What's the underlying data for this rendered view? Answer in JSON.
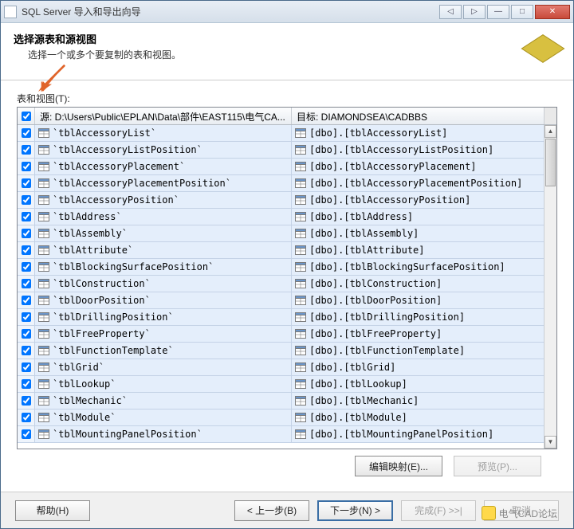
{
  "window": {
    "title": "SQL Server 导入和导出向导"
  },
  "header": {
    "title": "选择源表和源视图",
    "subtitle": "选择一个或多个要复制的表和视图。"
  },
  "section_label": "表和视图(T):",
  "columns": {
    "source": "源: D:\\Users\\Public\\EPLAN\\Data\\部件\\EAST115\\电气CA...",
    "target": "目标: DIAMONDSEA\\CADBBS"
  },
  "rows": [
    {
      "src": "`tblAccessoryList`",
      "tgt": "[dbo].[tblAccessoryList]"
    },
    {
      "src": "`tblAccessoryListPosition`",
      "tgt": "[dbo].[tblAccessoryListPosition]"
    },
    {
      "src": "`tblAccessoryPlacement`",
      "tgt": "[dbo].[tblAccessoryPlacement]"
    },
    {
      "src": "`tblAccessoryPlacementPosition`",
      "tgt": "[dbo].[tblAccessoryPlacementPosition]"
    },
    {
      "src": "`tblAccessoryPosition`",
      "tgt": "[dbo].[tblAccessoryPosition]"
    },
    {
      "src": "`tblAddress`",
      "tgt": "[dbo].[tblAddress]"
    },
    {
      "src": "`tblAssembly`",
      "tgt": "[dbo].[tblAssembly]"
    },
    {
      "src": "`tblAttribute`",
      "tgt": "[dbo].[tblAttribute]"
    },
    {
      "src": "`tblBlockingSurfacePosition`",
      "tgt": "[dbo].[tblBlockingSurfacePosition]"
    },
    {
      "src": "`tblConstruction`",
      "tgt": "[dbo].[tblConstruction]"
    },
    {
      "src": "`tblDoorPosition`",
      "tgt": "[dbo].[tblDoorPosition]"
    },
    {
      "src": "`tblDrillingPosition`",
      "tgt": "[dbo].[tblDrillingPosition]"
    },
    {
      "src": "`tblFreeProperty`",
      "tgt": "[dbo].[tblFreeProperty]"
    },
    {
      "src": "`tblFunctionTemplate`",
      "tgt": "[dbo].[tblFunctionTemplate]"
    },
    {
      "src": "`tblGrid`",
      "tgt": "[dbo].[tblGrid]"
    },
    {
      "src": "`tblLookup`",
      "tgt": "[dbo].[tblLookup]"
    },
    {
      "src": "`tblMechanic`",
      "tgt": "[dbo].[tblMechanic]"
    },
    {
      "src": "`tblModule`",
      "tgt": "[dbo].[tblModule]"
    },
    {
      "src": "`tblMountingPanelPosition`",
      "tgt": "[dbo].[tblMountingPanelPosition]"
    }
  ],
  "buttons": {
    "edit_mapping": "编辑映射(E)...",
    "preview": "预览(P)...",
    "help": "帮助(H)",
    "back": "< 上一步(B)",
    "next": "下一步(N) >",
    "finish": "完成(F) >>|",
    "cancel": "取消"
  },
  "watermark": "电气CAD论坛"
}
